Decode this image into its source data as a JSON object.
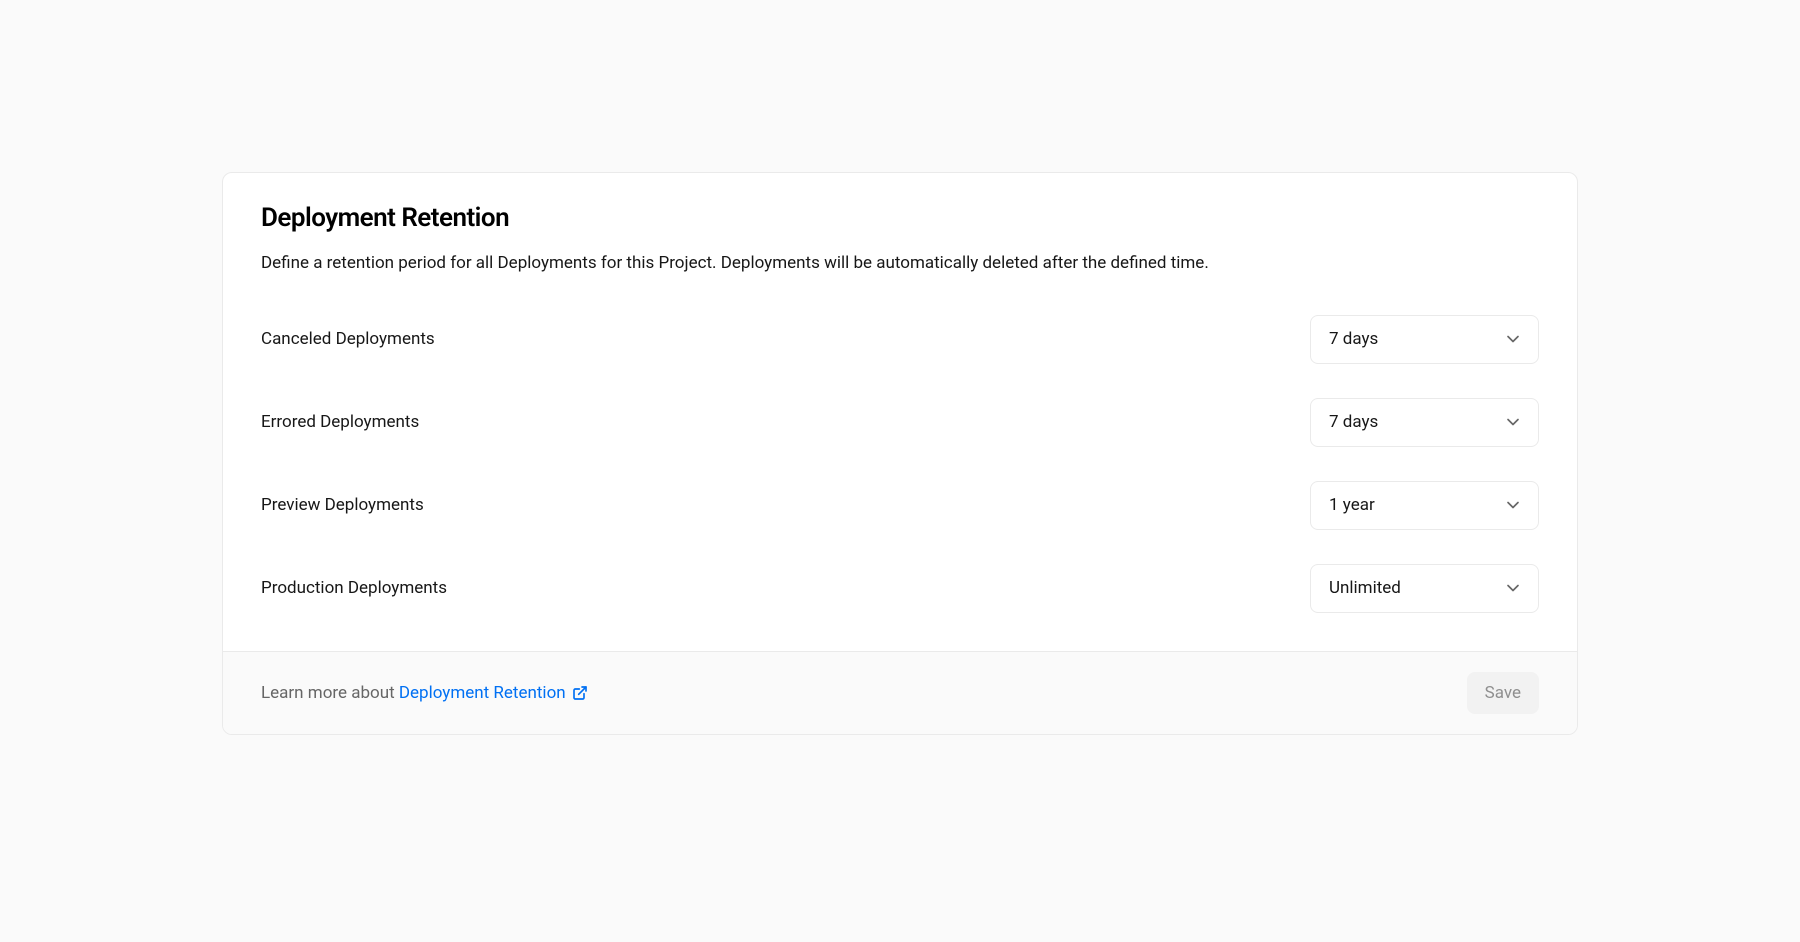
{
  "card": {
    "title": "Deployment Retention",
    "description": "Define a retention period for all Deployments for this Project. Deployments will be automatically deleted after the defined time."
  },
  "settings": [
    {
      "label": "Canceled Deployments",
      "value": "7 days"
    },
    {
      "label": "Errored Deployments",
      "value": "7 days"
    },
    {
      "label": "Preview Deployments",
      "value": "1 year"
    },
    {
      "label": "Production Deployments",
      "value": "Unlimited"
    }
  ],
  "footer": {
    "learn_more_prefix": "Learn more about ",
    "link_text": "Deployment Retention",
    "save_label": "Save"
  }
}
